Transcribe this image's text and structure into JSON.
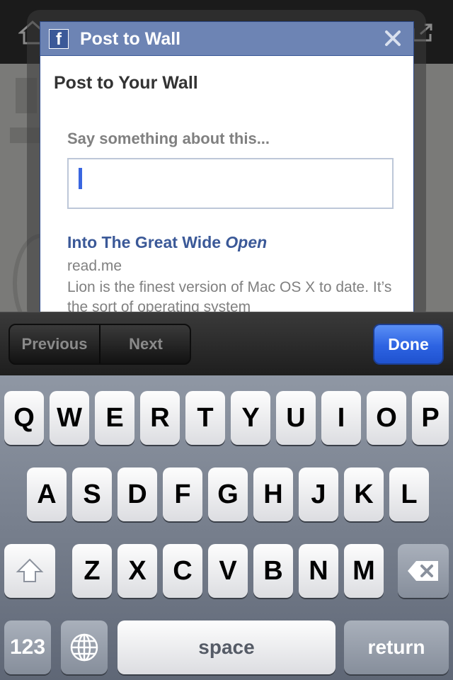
{
  "dialog": {
    "header_title": "Post to Wall",
    "logo_letter": "f",
    "heading": "Post to Your Wall",
    "prompt_label": "Say something about this...",
    "message_value": "",
    "link": {
      "title_main": "Into The Great Wide ",
      "title_em": "Open",
      "domain": "read.me",
      "description": "Lion is the finest version of Mac OS X to date. It’s the sort of operating system"
    }
  },
  "toolbar": {
    "previous_label": "Previous",
    "next_label": "Next",
    "done_label": "Done"
  },
  "keyboard": {
    "row1": [
      "Q",
      "W",
      "E",
      "R",
      "T",
      "Y",
      "U",
      "I",
      "O",
      "P"
    ],
    "row2": [
      "A",
      "S",
      "D",
      "F",
      "G",
      "H",
      "J",
      "K",
      "L"
    ],
    "row3": [
      "Z",
      "X",
      "C",
      "V",
      "B",
      "N",
      "M"
    ],
    "numbers_label": "123",
    "space_label": "space",
    "return_label": "return"
  },
  "icons": {
    "shift": "shift-icon",
    "delete": "delete-icon",
    "globe": "globe-icon",
    "close": "close-icon",
    "home": "home-icon",
    "share": "share-icon"
  },
  "colors": {
    "facebook_header": "#6d84b4",
    "facebook_link": "#3b5998",
    "done_button": "#2d63e2"
  }
}
